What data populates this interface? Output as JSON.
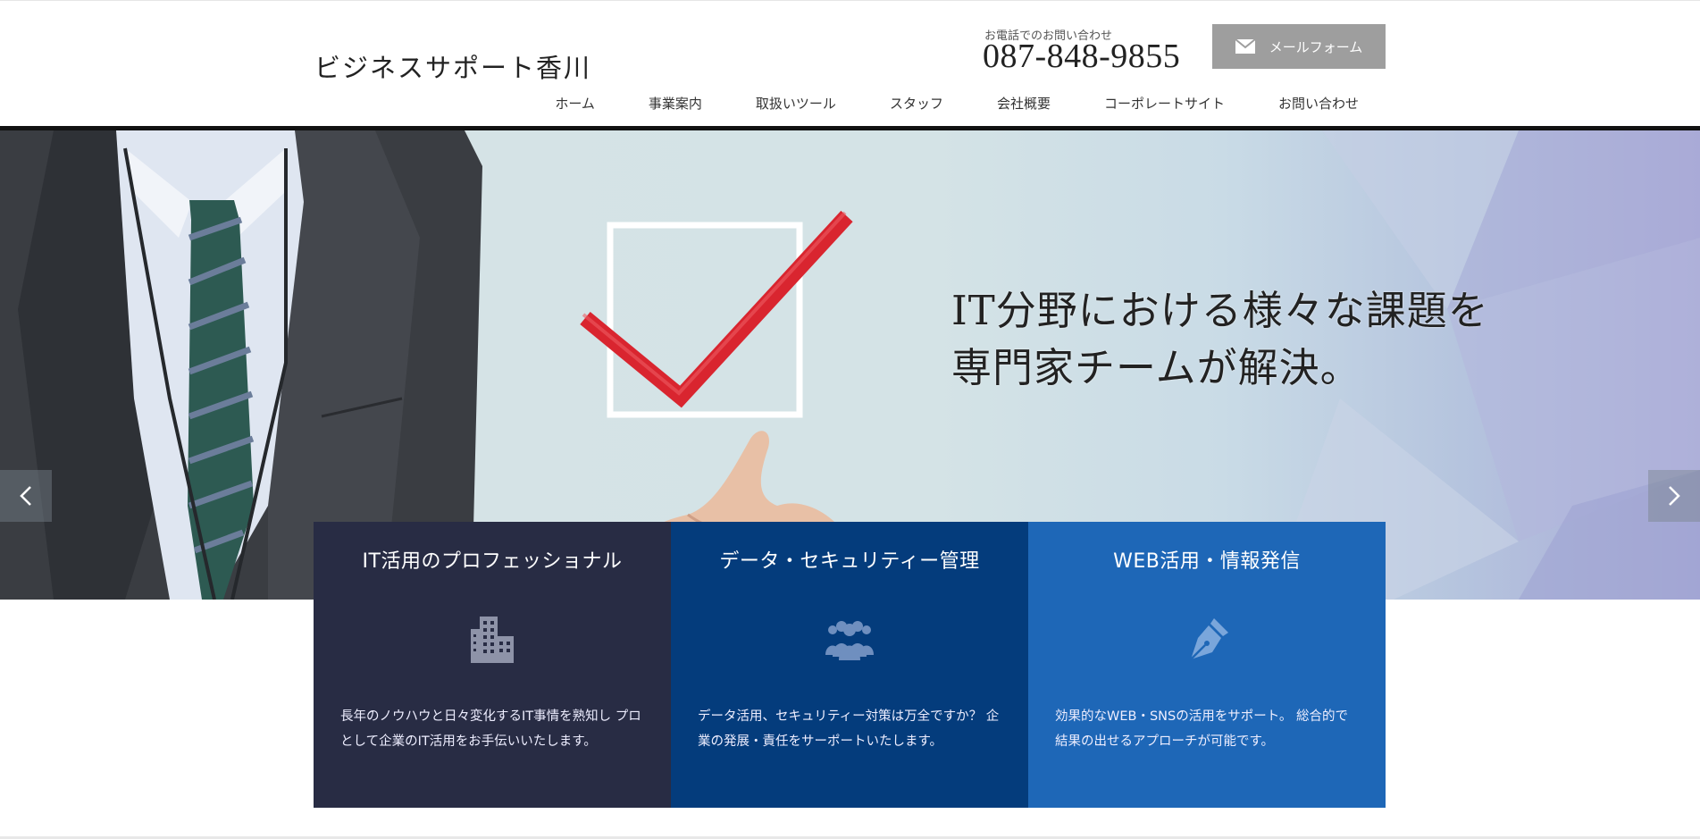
{
  "header": {
    "logo": "ビジネスサポート香川",
    "tel_label": "お電話でのお問い合わせ",
    "tel_number": "087-848-9855",
    "mail_button": "メールフォーム",
    "nav": [
      {
        "label": "ホーム"
      },
      {
        "label": "事業案内"
      },
      {
        "label": "取扱いツール"
      },
      {
        "label": "スタッフ"
      },
      {
        "label": "会社概要"
      },
      {
        "label": "コーポレートサイト"
      },
      {
        "label": "お問い合わせ"
      }
    ]
  },
  "hero": {
    "caption_line1": "IT分野における様々な課題を",
    "caption_line2": "専門家チームが解決。",
    "prev_icon": "chevron-left-icon",
    "next_icon": "chevron-right-icon"
  },
  "features": [
    {
      "title": "IT活用のプロフェッショナル",
      "icon": "building-icon",
      "text": "長年のノウハウと日々変化するIT事情を熟知し プロとして企業のIT活用をお手伝いいたします。"
    },
    {
      "title": "データ・セキュリティー管理",
      "icon": "users-icon",
      "text": "データ活用、セキュリティー対策は万全ですか？ 企業の発展・責任をサーポートいたします。"
    },
    {
      "title": "WEB活用・情報発信",
      "icon": "pen-icon",
      "text": "効果的なWEB・SNSの活用をサポート。 総合的で結果の出せるアプローチが可能です。"
    }
  ],
  "colors": {
    "feature1": "#282c44",
    "feature2": "#043c7c",
    "feature3": "#1e67b7",
    "mail_button": "#9e9e9e",
    "check_mark": "#d9252f"
  }
}
